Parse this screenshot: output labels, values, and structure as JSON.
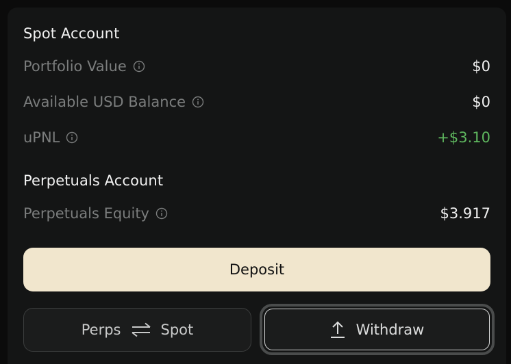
{
  "spot": {
    "title": "Spot Account",
    "rows": [
      {
        "label": "Portfolio Value",
        "value": "$0"
      },
      {
        "label": "Available USD Balance",
        "value": "$0"
      },
      {
        "label": "uPNL",
        "value": "+$3.10"
      }
    ]
  },
  "perps": {
    "title": "Perpetuals Account",
    "rows": [
      {
        "label": "Perpetuals Equity",
        "value": "$3.917"
      }
    ]
  },
  "actions": {
    "deposit_label": "Deposit",
    "transfer_from": "Perps",
    "transfer_to": "Spot",
    "withdraw_label": "Withdraw"
  },
  "colors": {
    "panel_bg": "#141515",
    "deposit_bg": "#f1e6cd",
    "positive": "#5fb85f",
    "muted_label": "#7b7d7d"
  },
  "icons": {
    "info": "info-circle-icon",
    "swap": "swap-arrows-icon",
    "withdraw": "upload-arrow-icon"
  }
}
